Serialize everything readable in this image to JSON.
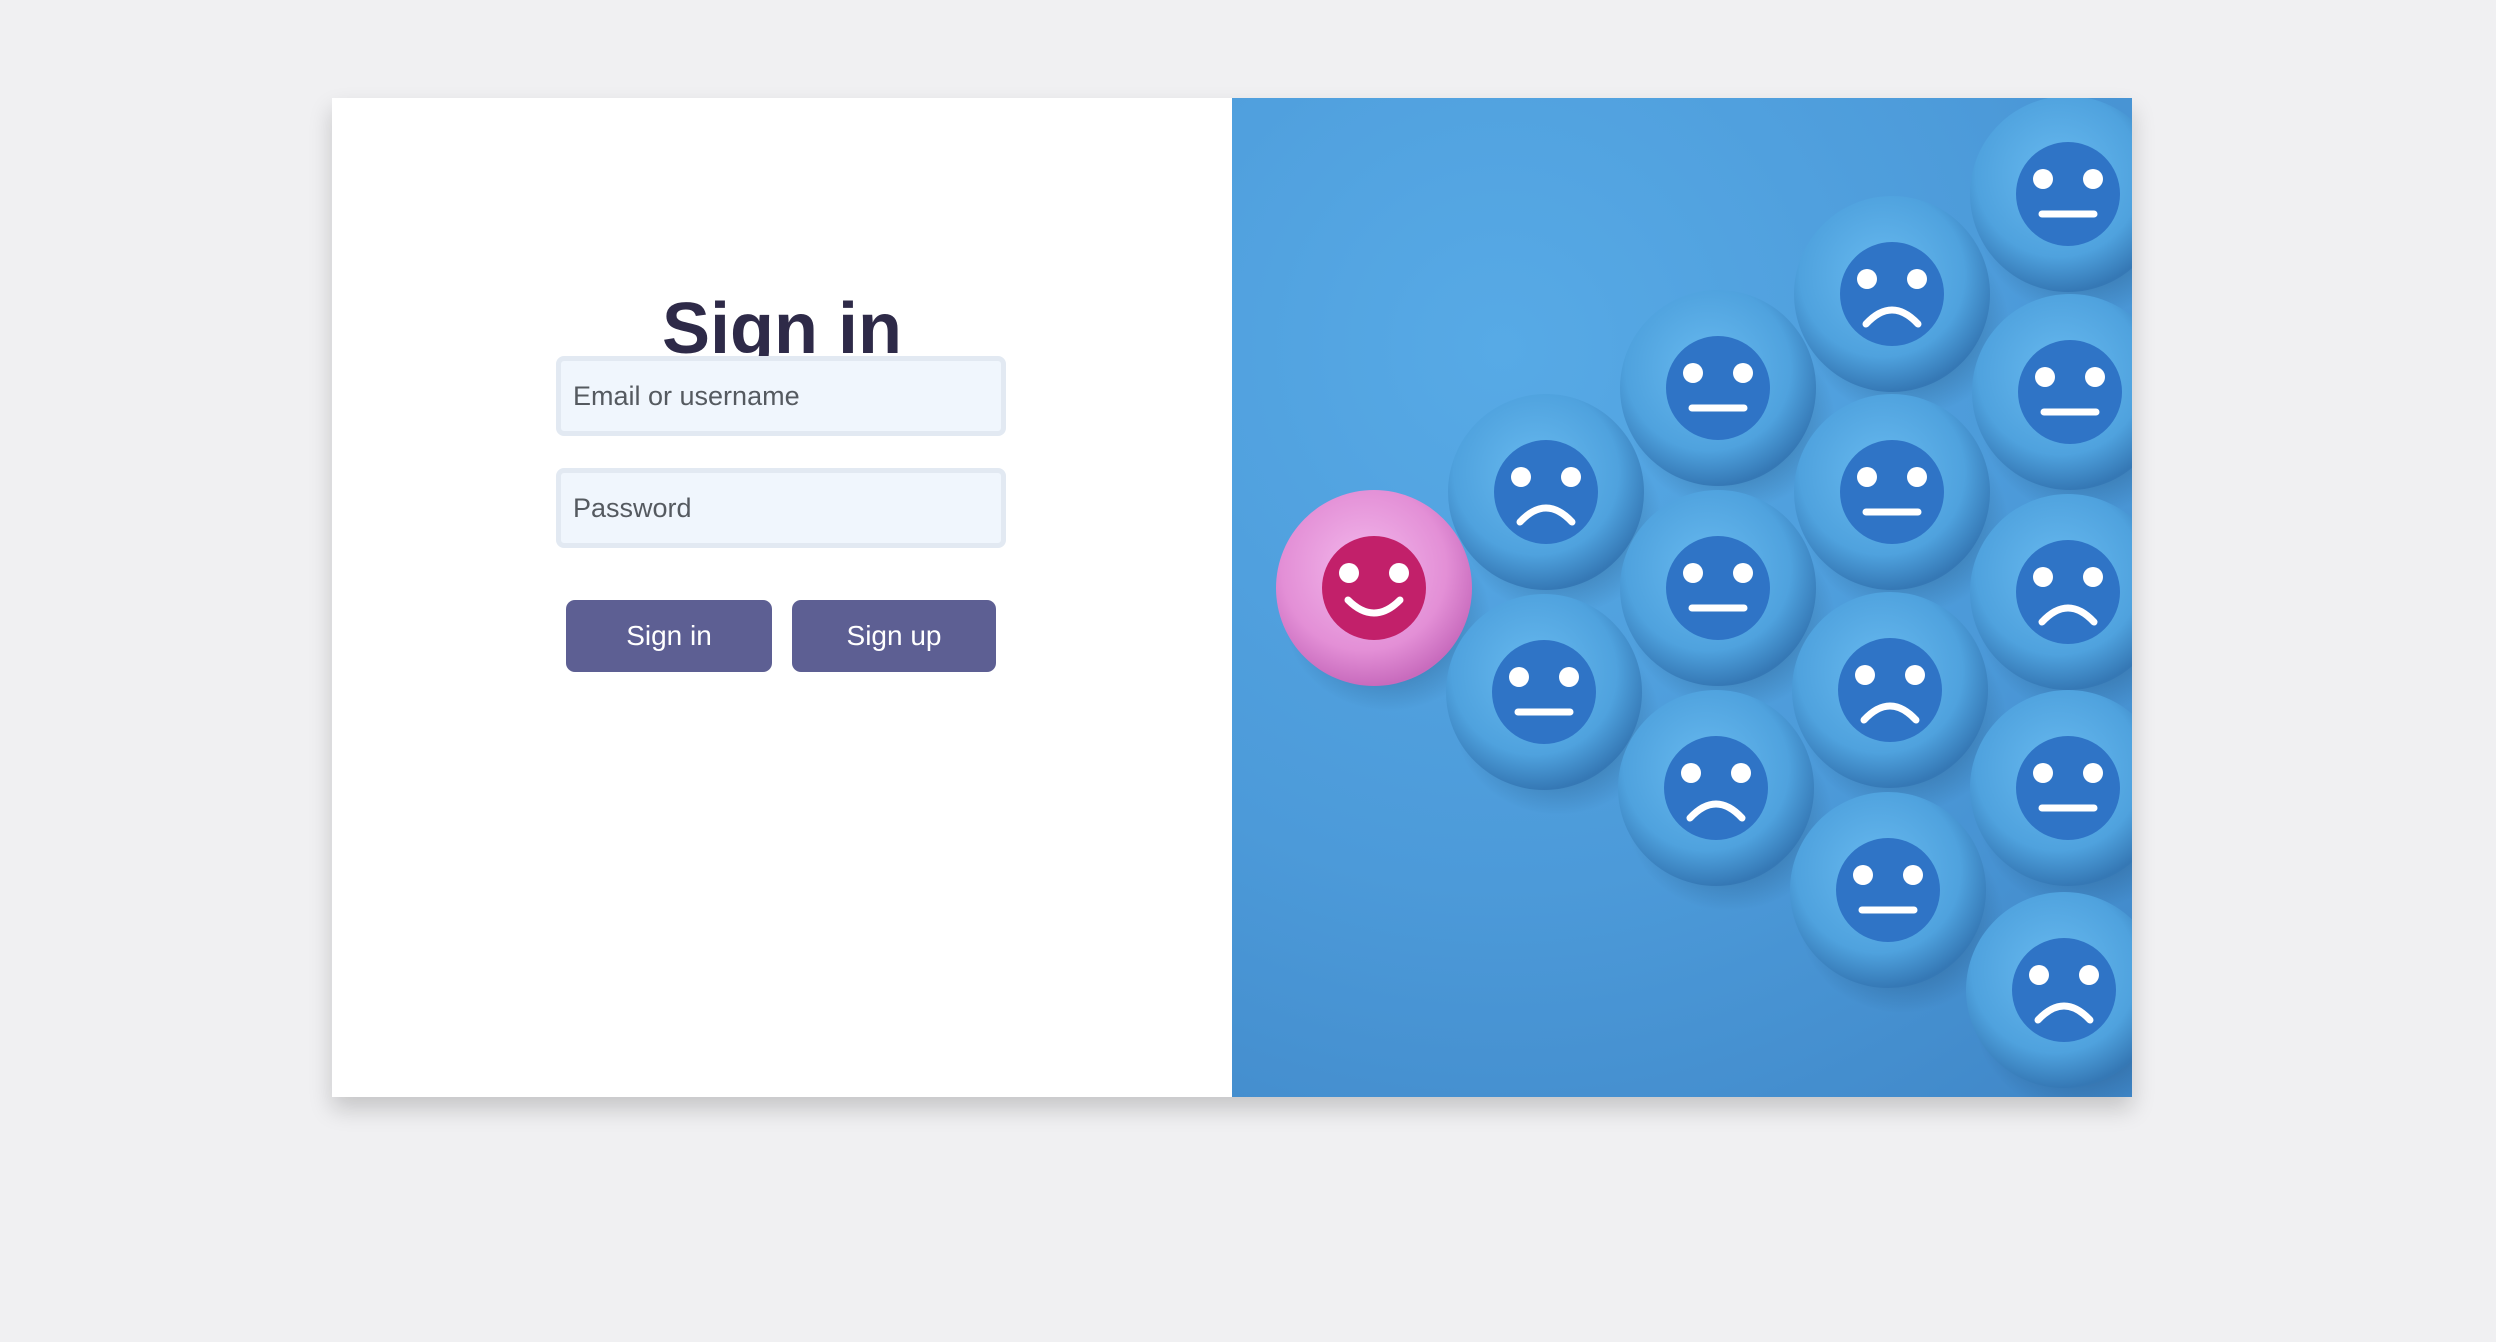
{
  "login": {
    "title": "Sign in",
    "email_placeholder": "Email or username",
    "password_placeholder": "Password",
    "signin_label": "Sign in",
    "signup_label": "Sign up"
  },
  "illustration": {
    "faces": [
      {
        "mood": "happy",
        "color": "pink"
      },
      {
        "mood": "sad"
      },
      {
        "mood": "neutral"
      },
      {
        "mood": "neutral"
      },
      {
        "mood": "neutral"
      },
      {
        "mood": "sad"
      },
      {
        "mood": "sad"
      },
      {
        "mood": "neutral"
      },
      {
        "mood": "sad"
      },
      {
        "mood": "neutral"
      },
      {
        "mood": "neutral"
      },
      {
        "mood": "neutral"
      },
      {
        "mood": "sad"
      },
      {
        "mood": "neutral"
      },
      {
        "mood": "sad"
      }
    ]
  },
  "colors": {
    "title": "#2e2a48",
    "button": "#5d5f93",
    "input_bg": "#f0f6fd",
    "image_bg": "#4c9ad9",
    "happy_face": "#c2206a"
  }
}
